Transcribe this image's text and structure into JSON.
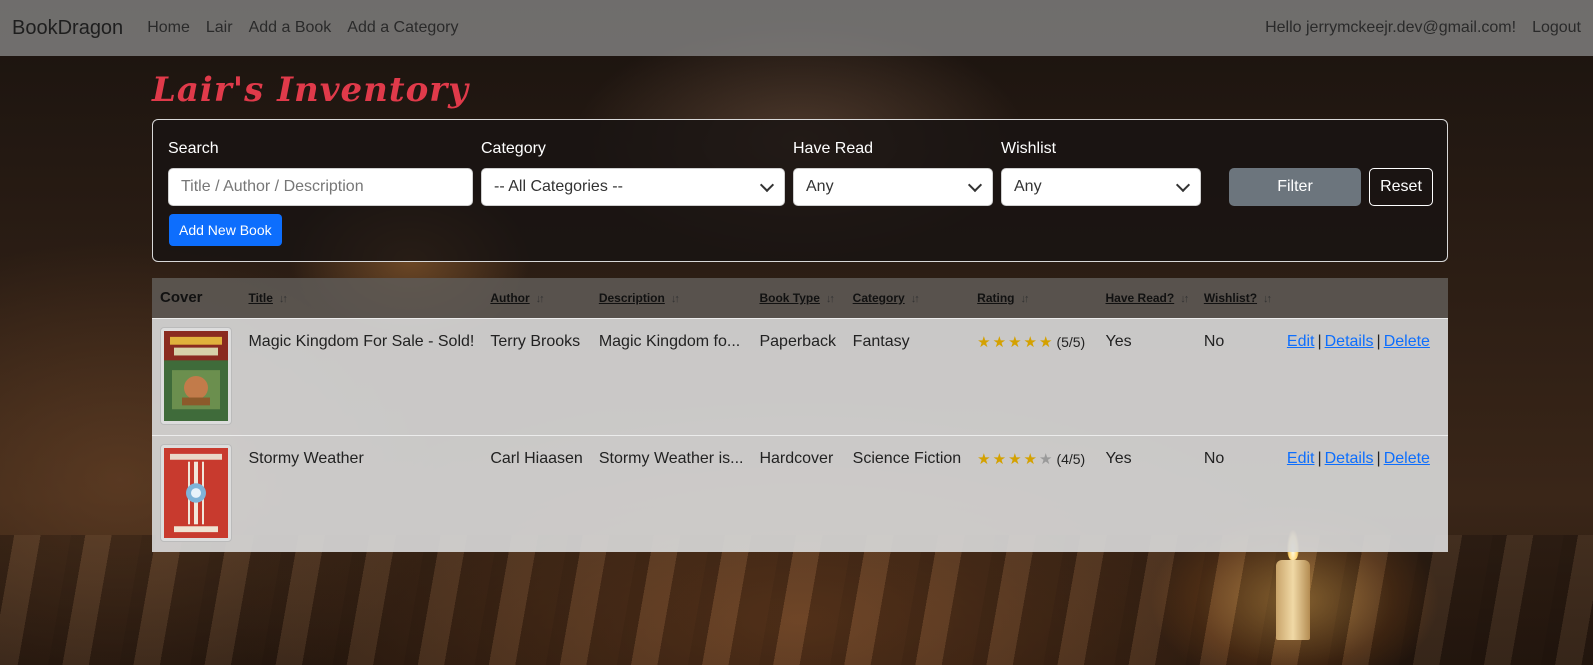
{
  "navbar": {
    "brand": "BookDragon",
    "links": [
      "Home",
      "Lair",
      "Add a Book",
      "Add a Category"
    ],
    "greeting": "Hello jerrymckeejr.dev@gmail.com!",
    "logout": "Logout"
  },
  "page": {
    "title": "Lair's Inventory"
  },
  "filters": {
    "search_label": "Search",
    "search_placeholder": "Title / Author / Description",
    "category_label": "Category",
    "category_value": "-- All Categories --",
    "have_read_label": "Have Read",
    "have_read_value": "Any",
    "wishlist_label": "Wishlist",
    "wishlist_value": "Any",
    "filter_button": "Filter",
    "reset_button": "Reset",
    "add_button": "Add New Book"
  },
  "table": {
    "headers": {
      "cover": "Cover",
      "title": "Title",
      "author": "Author",
      "description": "Description",
      "book_type": "Book Type",
      "category": "Category",
      "rating": "Rating",
      "have_read": "Have Read?",
      "wishlist": "Wishlist?"
    },
    "sort_icon": "sort-arrows-icon",
    "rows": [
      {
        "cover_icon": "book-cover-magic-kingdom",
        "title": "Magic Kingdom For Sale - Sold!",
        "author": "Terry Brooks",
        "description": "Magic Kingdom fo...",
        "book_type": "Paperback",
        "category": "Fantasy",
        "rating": 5,
        "rating_text": "(5/5)",
        "have_read": "Yes",
        "wishlist": "No"
      },
      {
        "cover_icon": "book-cover-stormy-weather",
        "title": "Stormy Weather",
        "author": "Carl Hiaasen",
        "description": "Stormy Weather is...",
        "book_type": "Hardcover",
        "category": "Science Fiction",
        "rating": 4,
        "rating_text": "(4/5)",
        "have_read": "Yes",
        "wishlist": "No"
      }
    ],
    "actions": {
      "edit": "Edit",
      "details": "Details",
      "delete": "Delete",
      "separator": "|"
    }
  },
  "colors": {
    "title_accent": "#e03a4a",
    "primary": "#0d6efd",
    "secondary": "#6c757d",
    "star": "#d4a100"
  }
}
